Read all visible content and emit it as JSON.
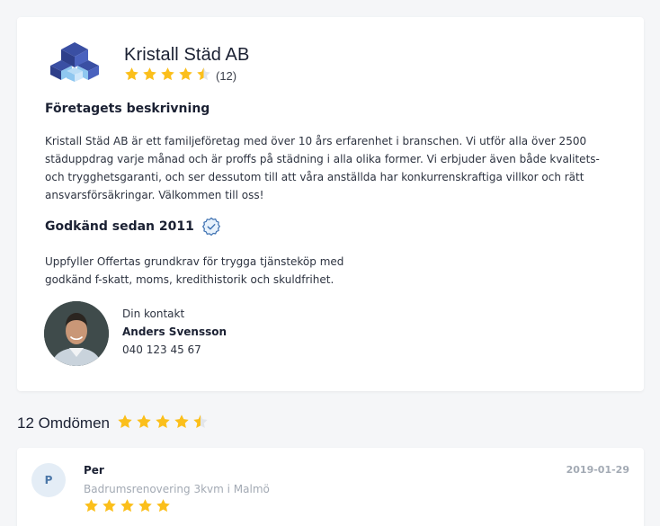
{
  "company": {
    "name": "Kristall Städ AB",
    "rating": 4.5,
    "review_count": "(12)",
    "star_color": "#fbbf1b",
    "description_title": "Företagets beskrivning",
    "description": "Kristall Städ AB är ett familjeföretag med över 10 års erfarenhet i branschen. Vi utför alla över 2500 städuppdrag varje månad och är proffs på städning i alla olika former. Vi erbjuder även både kvalitets- och trygghetsgaranti, och ser dessutom till att våra anställda har konkurrenskraftiga villkor och rätt ansvarsförsäkringar. Välkommen till oss!",
    "approved_title": "Godkänd sedan 2011",
    "approved_text": "Uppfyller Offertas grundkrav för trygga tjänsteköp med godkänd f-skatt, moms, kredithistorik och skuldfrihet.",
    "icons": {
      "logo": "cube-logo",
      "approved": "verified-badge-icon"
    }
  },
  "contact": {
    "label": "Din kontakt",
    "name": "Anders Svensson",
    "phone": "040 123 45 67"
  },
  "reviews": {
    "heading": "12 Omdömen",
    "rating": 4.5,
    "items": [
      {
        "initial": "P",
        "name": "Per",
        "date": "2019-01-29",
        "job": "Badrumsrenovering 3kvm i Malmö",
        "rating": 5
      }
    ]
  }
}
